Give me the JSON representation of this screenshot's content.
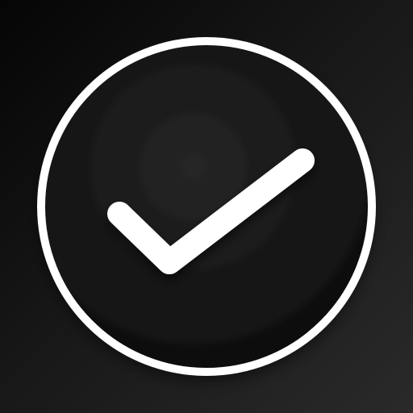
{
  "icon": {
    "name": "check-circle-icon",
    "description_hidden": "",
    "colors": {
      "background_dark": "#050505",
      "background_light": "#2a2a2a",
      "circle_fill_inner": "#262626",
      "circle_fill_outer": "#0d0d0d",
      "ring": "#ffffff",
      "check": "#ffffff"
    }
  }
}
